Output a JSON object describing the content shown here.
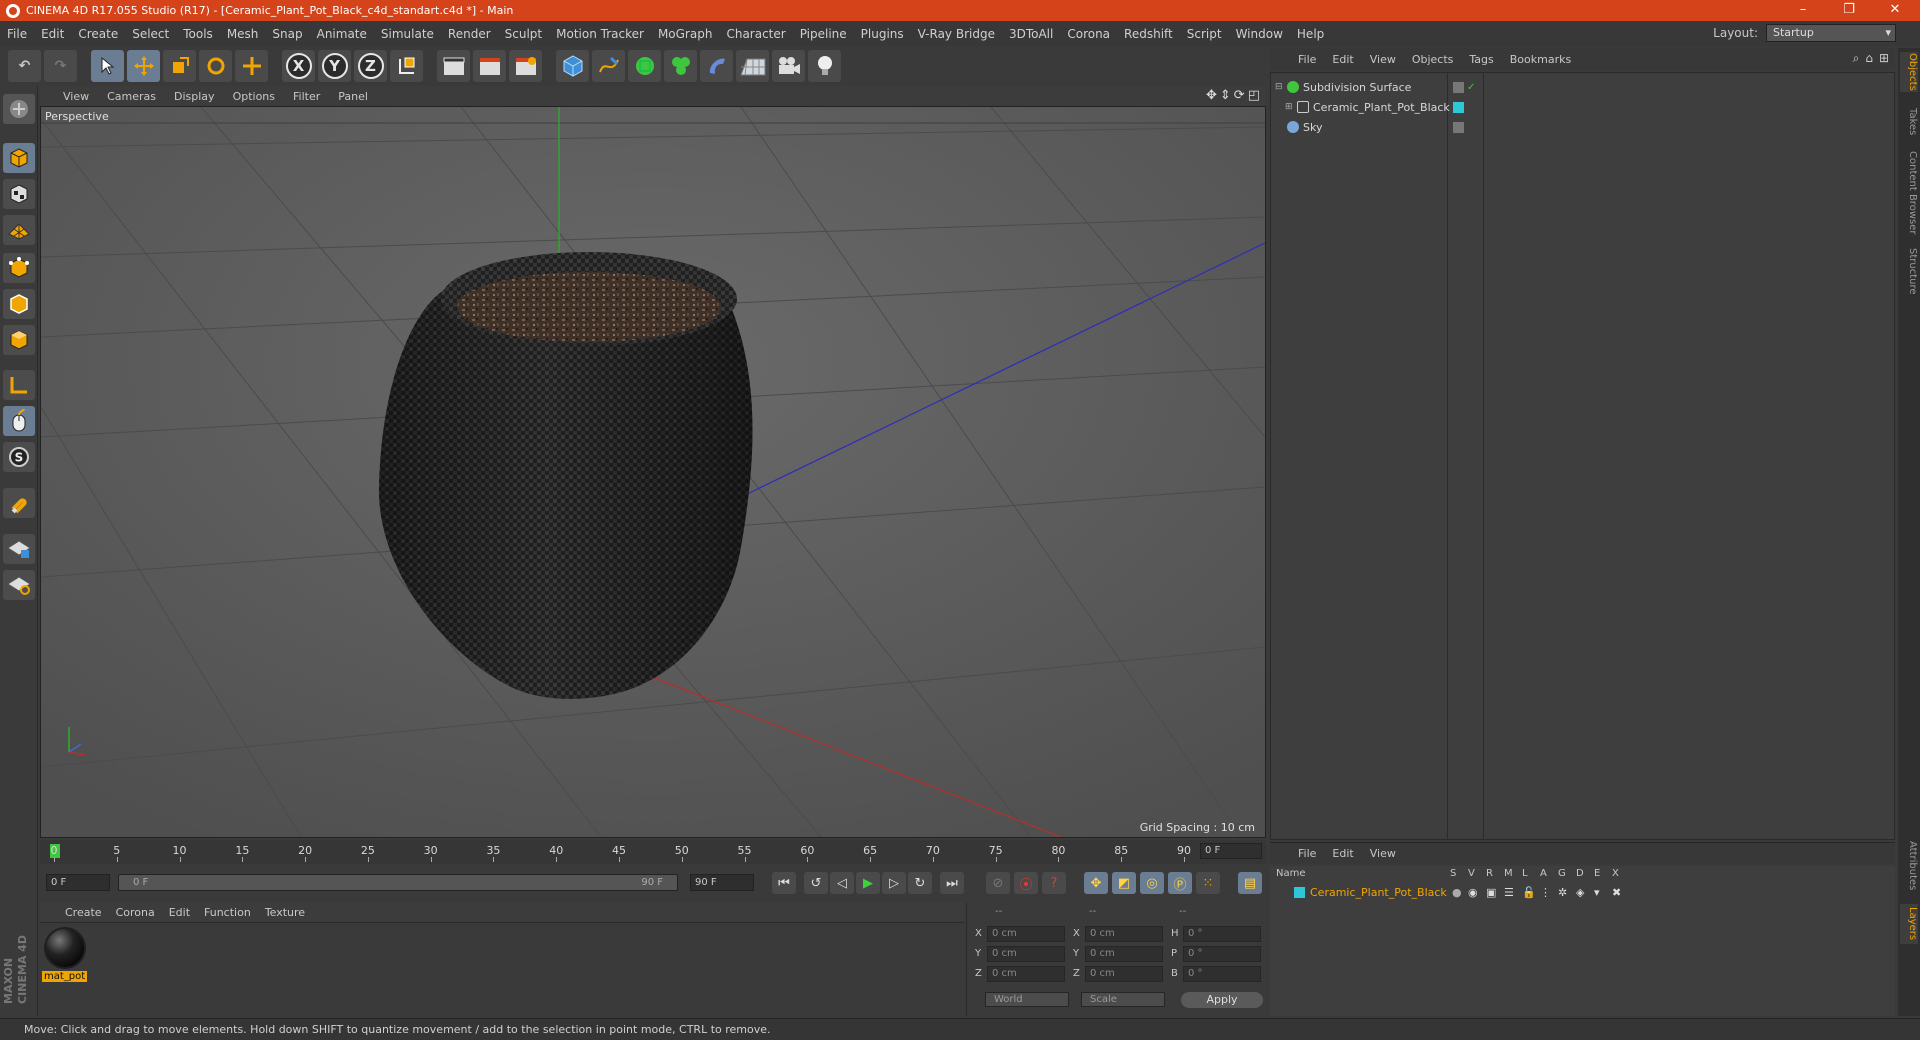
{
  "window": {
    "title": "CINEMA 4D R17.055 Studio (R17) - [Ceramic_Plant_Pot_Black_c4d_standart.c4d *] - Main",
    "controls": [
      "–",
      "❐",
      "✕"
    ]
  },
  "menubar": {
    "items": [
      "File",
      "Edit",
      "Create",
      "Select",
      "Tools",
      "Mesh",
      "Snap",
      "Animate",
      "Simulate",
      "Render",
      "Sculpt",
      "Motion Tracker",
      "MoGraph",
      "Character",
      "Pipeline",
      "Plugins",
      "V-Ray Bridge",
      "3DToAll",
      "Corona",
      "Redshift",
      "Script",
      "Window",
      "Help"
    ],
    "layout_label": "Layout:",
    "layout_value": "Startup"
  },
  "toolbar": {
    "undo": "↶",
    "redo": "↷",
    "x_axis": "X",
    "y_axis": "Y",
    "z_axis": "Z"
  },
  "viewport": {
    "menu": [
      "View",
      "Cameras",
      "Display",
      "Options",
      "Filter",
      "Panel"
    ],
    "label": "Perspective",
    "grid_spacing": "Grid Spacing : 10 cm"
  },
  "timeline": {
    "ticks": [
      "0",
      "5",
      "10",
      "15",
      "20",
      "25",
      "30",
      "35",
      "40",
      "45",
      "50",
      "55",
      "60",
      "65",
      "70",
      "75",
      "80",
      "85",
      "90"
    ],
    "current_frame": "0 F"
  },
  "playback": {
    "start_frame": "0 F",
    "range_start": "0 F",
    "range_end": "90 F",
    "end_frame": "90 F"
  },
  "materials": {
    "menu": [
      "Create",
      "Corona",
      "Edit",
      "Function",
      "Texture"
    ],
    "items": [
      {
        "name": "mat_pot"
      }
    ]
  },
  "coordinates": {
    "header": [
      "--",
      "--",
      "--"
    ],
    "rows": [
      {
        "axis": "X",
        "pos": "0 cm",
        "size_axis": "X",
        "size": "0 cm",
        "rot_axis": "H",
        "rot": "0 °"
      },
      {
        "axis": "Y",
        "pos": "0 cm",
        "size_axis": "Y",
        "size": "0 cm",
        "rot_axis": "P",
        "rot": "0 °"
      },
      {
        "axis": "Z",
        "pos": "0 cm",
        "size_axis": "Z",
        "size": "0 cm",
        "rot_axis": "B",
        "rot": "0 °"
      }
    ],
    "space": "World",
    "mode": "Scale",
    "apply": "Apply"
  },
  "status": "Move: Click and drag to move elements. Hold down SHIFT to quantize movement / add to the selection in point mode, CTRL to remove.",
  "object_manager": {
    "menu": [
      "File",
      "Edit",
      "View",
      "Objects",
      "Tags",
      "Bookmarks"
    ],
    "objects": [
      {
        "name": "Subdivision Surface",
        "color": "#3ec63e"
      },
      {
        "name": "Ceramic_Plant_Pot_Black",
        "color": "#7cd4d9"
      },
      {
        "name": "Sky",
        "color": "#7aa6d8"
      }
    ]
  },
  "layer_manager": {
    "menu": [
      "File",
      "Edit",
      "View"
    ],
    "columns": [
      "Name",
      "S",
      "V",
      "R",
      "M",
      "L",
      "A",
      "G",
      "D",
      "E",
      "X"
    ],
    "layers": [
      {
        "name": "Ceramic_Plant_Pot_Black",
        "color": "#2ec7d6"
      }
    ]
  },
  "right_tabs": [
    "Objects",
    "Takes",
    "Content Browser",
    "Structure",
    "Attributes",
    "Layers"
  ],
  "colors": {
    "titlebar": "#d5431b",
    "accent_orange": "#f0a500",
    "active_button": "#6a7d92"
  },
  "logo": {
    "line1": "MAXON",
    "line2": "CINEMA 4D"
  }
}
